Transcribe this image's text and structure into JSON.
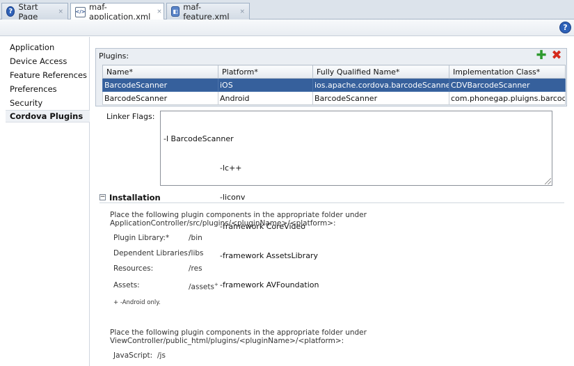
{
  "tabs": [
    {
      "label": "Start Page",
      "icon": "help-icon"
    },
    {
      "label": "maf-application.xml",
      "icon": "xml-file-icon",
      "active": true
    },
    {
      "label": "maf-feature.xml",
      "icon": "feature-file-icon"
    }
  ],
  "tab_close_glyph": "×",
  "toolbar": {
    "help_glyph": "?"
  },
  "nav": {
    "items": [
      {
        "label": "Application"
      },
      {
        "label": "Device Access"
      },
      {
        "label": "Feature References"
      },
      {
        "label": "Preferences"
      },
      {
        "label": "Security"
      },
      {
        "label": "Cordova Plugins",
        "selected": true
      }
    ]
  },
  "plugins": {
    "label": "Plugins:",
    "add_glyph": "✚",
    "delete_glyph": "✖",
    "columns": [
      "Name*",
      "Platform*",
      "Fully Qualified Name*",
      "Implementation Class*"
    ],
    "rows": [
      [
        "BarcodeScanner",
        "iOS",
        "ios.apache.cordova.barcodeScanner",
        "CDVBarcodeScanner"
      ],
      [
        "BarcodeScanner",
        "Android",
        "BarcodeScanner",
        "com.phonegap.pluigns.barcode..."
      ]
    ]
  },
  "linker": {
    "label": "Linker Flags:",
    "lines": [
      "-l BarcodeScanner",
      "-lc++",
      "-liconv",
      "-framework CoreVideo",
      "-framework AssetsLibrary",
      "-framework AVFoundation"
    ]
  },
  "installation": {
    "title": "Installation",
    "collapse_glyph": "−",
    "intro1": "Place the following plugin components in the appropriate folder under ApplicationController/src/plugins/<pluginName>/<platform>:",
    "rows": [
      {
        "label": "Plugin Library:*",
        "value": "/bin"
      },
      {
        "label": "Dependent Libraries:",
        "value": "/libs"
      },
      {
        "label": "Resources:",
        "value": "/res"
      },
      {
        "label": "Assets:",
        "value": "/assets"
      }
    ],
    "assets_sup": "+",
    "note": "+ -Android only.",
    "intro2": "Place the following plugin components in the appropriate folder under ViewController/public_html/plugins/<pluginName>/<platform>:",
    "js_label": "JavaScript:",
    "js_value": "/js"
  }
}
